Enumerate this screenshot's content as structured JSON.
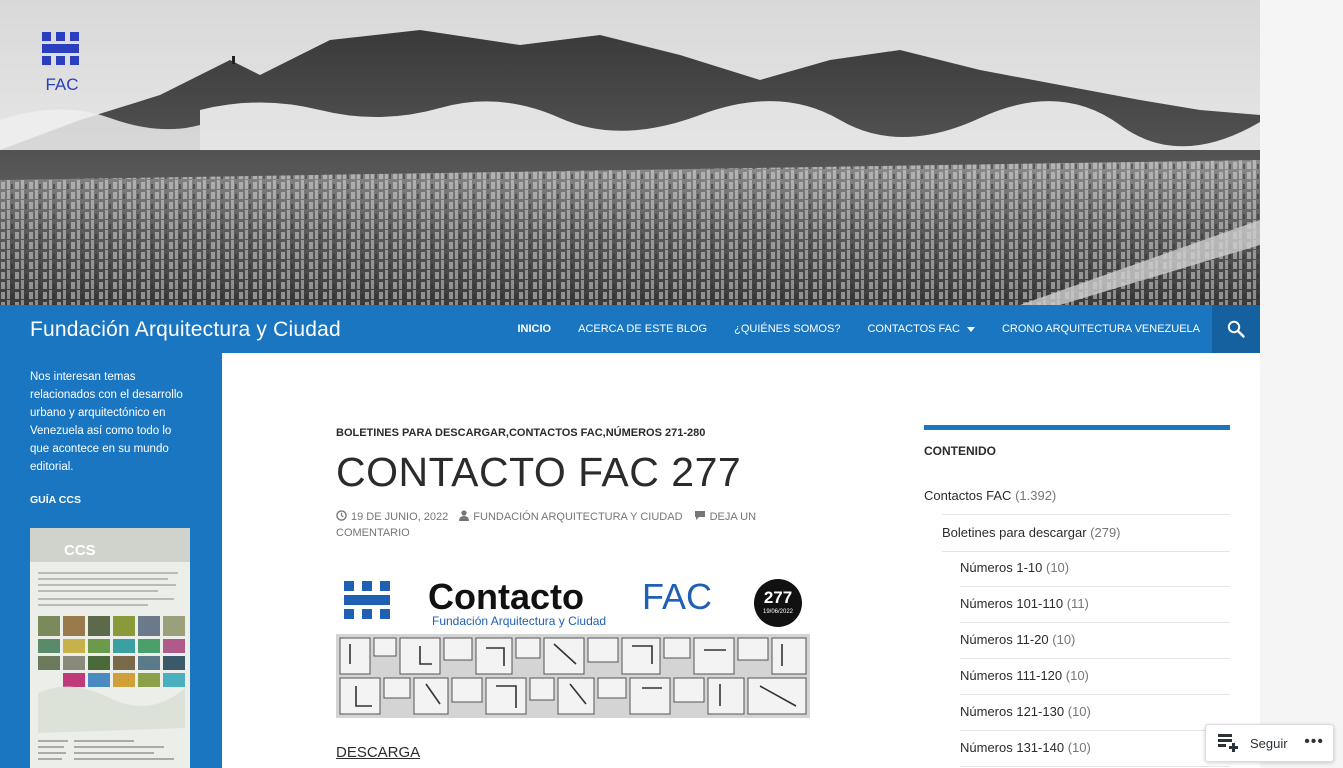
{
  "header": {
    "logo_text": "FAC",
    "site_title": "Fundación Arquitectura y Ciudad",
    "nav": [
      {
        "label": "INICIO",
        "current": true
      },
      {
        "label": "ACERCA DE ESTE BLOG"
      },
      {
        "label": "¿QUIÉNES SOMOS?"
      },
      {
        "label": "CONTACTOS FAC",
        "has_dropdown": true
      },
      {
        "label": "CRONO ARQUITECTURA VENEZUELA"
      }
    ],
    "search_icon": "search-icon",
    "brand_color": "#1a76c1"
  },
  "left_sidebar": {
    "tagline": "Nos interesan temas relacionados con el desarrollo urbano y arquitectónico en Venezuela así como todo lo que acontece en su mundo editorial.",
    "guia_title": "GUÍA CCS",
    "guia_image_label": "CCS"
  },
  "post": {
    "categories": "BOLETINES PARA DESCARGAR,CONTACTOS FAC,NÚMEROS 271-280",
    "title": "CONTACTO FAC 277",
    "date": "19 DE JUNIO, 2022",
    "author": "FUNDACIÓN ARQUITECTURA Y CIUDAD",
    "comment": "DEJA UN COMENTARIO",
    "banner": {
      "title_a": "Contacto",
      "title_b": "FAC",
      "subtitle": "Fundación Arquitectura y Ciudad",
      "issue_number": "277",
      "issue_date": "19/06/2022"
    },
    "download_link": "DESCARGA"
  },
  "right_sidebar": {
    "widget_title": "CONTENIDO",
    "categories": [
      {
        "label": "Contactos FAC",
        "count": "(1.392)"
      },
      {
        "label": "Boletines para descargar",
        "count": "(279)"
      },
      {
        "label": "Números 1-10",
        "count": "(10)"
      },
      {
        "label": "Números 101-110",
        "count": "(11)"
      },
      {
        "label": "Números 11-20",
        "count": "(10)"
      },
      {
        "label": "Números 111-120",
        "count": "(10)"
      },
      {
        "label": "Números 121-130",
        "count": "(10)"
      },
      {
        "label": "Números 131-140",
        "count": "(10)"
      }
    ]
  },
  "follow": {
    "label": "Seguir",
    "more": "•••"
  }
}
